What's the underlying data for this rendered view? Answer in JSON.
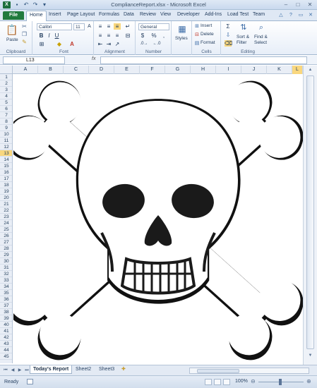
{
  "window": {
    "title": "ComplianceReport.xlsx - Microsoft Excel"
  },
  "ribbon_tabs": [
    "File",
    "Home",
    "Insert",
    "Page Layout",
    "Formulas",
    "Data",
    "Review",
    "View",
    "Developer",
    "Add-Ins",
    "Load Test",
    "Team"
  ],
  "active_tab": "Home",
  "clipboard": {
    "paste": "Paste",
    "label": "Clipboard"
  },
  "font": {
    "name": "Calibri",
    "size": "11",
    "label": "Font"
  },
  "alignment": {
    "label": "Alignment"
  },
  "number": {
    "format": "General",
    "label": "Number",
    "percent": "%",
    "comma": ","
  },
  "styles": {
    "label": "Styles"
  },
  "cells": {
    "insert": "Insert",
    "delete": "Delete",
    "format": "Format",
    "label": "Cells"
  },
  "editing": {
    "sort": "Sort &",
    "filter": "Filter",
    "find": "Find &",
    "select": "Select",
    "sigma": "Σ",
    "label": "Editing"
  },
  "formula_bar": {
    "name_box": "L13",
    "fx": "fx",
    "content": ""
  },
  "columns": [
    "A",
    "B",
    "C",
    "D",
    "E",
    "F",
    "G",
    "H",
    "I",
    "J",
    "K"
  ],
  "selected_column": "L",
  "rows": [
    "1",
    "2",
    "3",
    "4",
    "5",
    "6",
    "7",
    "8",
    "9",
    "10",
    "11",
    "12",
    "13",
    "14",
    "15",
    "16",
    "17",
    "18",
    "19",
    "20",
    "21",
    "22",
    "23",
    "24",
    "25",
    "26",
    "27",
    "28",
    "29",
    "30",
    "31",
    "32",
    "33",
    "34",
    "35",
    "36",
    "37",
    "38",
    "39",
    "40",
    "41",
    "42",
    "43",
    "44",
    "45"
  ],
  "selected_row": "13",
  "sheet_tabs": [
    "Today's Report",
    "Sheet2",
    "Sheet3"
  ],
  "active_sheet": "Today's Report",
  "status": {
    "ready": "Ready",
    "zoom": "100%"
  },
  "colors": {
    "accent": "#217a3d",
    "selection": "#f9d77e",
    "header_bg": "#e9eef6"
  }
}
